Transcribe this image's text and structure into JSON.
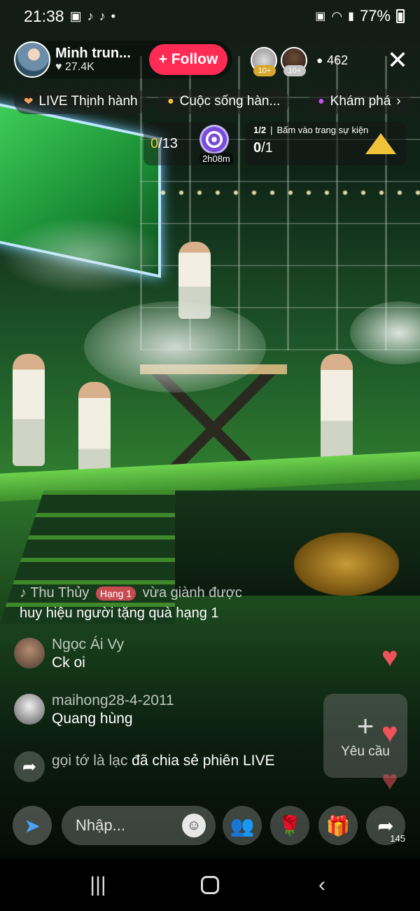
{
  "status_bar": {
    "time": "21:38",
    "battery": "77%"
  },
  "host": {
    "name": "Minh trun...",
    "likes": "27.4K",
    "follow_label": "+ Follow"
  },
  "viewers": {
    "badge_1": "10+",
    "badge_2": "10+",
    "count": "462"
  },
  "chips": [
    {
      "label": "LIVE Thịnh hành",
      "icon": "heart-icon"
    },
    {
      "label": "Cuộc sống hàn...",
      "icon": "coin-icon"
    },
    {
      "label": "Khám phá",
      "icon": "planet-icon"
    }
  ],
  "quest": {
    "progress_done": "0",
    "progress_total": "/13",
    "timer": "2h08m"
  },
  "event": {
    "page": "1/2",
    "hint": "Bấm vào trang sự kiện",
    "progress_done": "0",
    "progress_total": "/1"
  },
  "system_comment": {
    "name": "Thu Thủy",
    "rank": "Hạng 1",
    "text_1": "vừa giành được",
    "text_2": "huy hiệu người tặng quà hạng 1"
  },
  "comments": [
    {
      "user": "Ngọc Ái Vy",
      "text": "Ck oi"
    },
    {
      "user": "maihong28-4-2011",
      "text": "Quang hùng"
    }
  ],
  "share_comment": {
    "user": "gọi tớ là lạc",
    "text": "đã chia sẻ phiên LIVE"
  },
  "request": {
    "label": "Yêu cầu"
  },
  "bottom_bar": {
    "input_placeholder": "Nhập...",
    "share_count": "145"
  },
  "colors": {
    "follow": "#fe2c55",
    "heart": "#f0525a",
    "highlight": "#f7c341"
  }
}
